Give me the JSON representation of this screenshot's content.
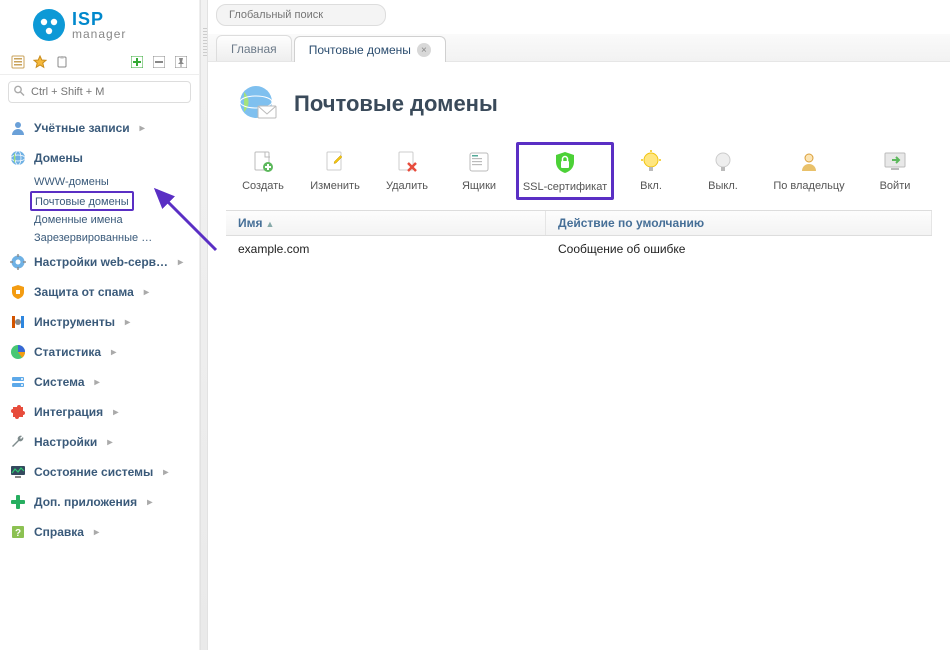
{
  "logo": {
    "brand": "ISP",
    "sub": "manager"
  },
  "search": {
    "placeholder": "Ctrl + Shift + M"
  },
  "global_search": {
    "placeholder": "Глобальный поиск"
  },
  "nav": {
    "accounts": "Учётные записи",
    "domains": "Домены",
    "domains_sub": {
      "www": "WWW-домены",
      "mail": "Почтовые домены",
      "dns": "Доменные имена",
      "reserved": "Зарезервированные …"
    },
    "webserver": "Настройки web-серв…",
    "antispam": "Защита от спама",
    "tools": "Инструменты",
    "stats": "Статистика",
    "system": "Система",
    "integration": "Интеграция",
    "settings": "Настройки",
    "state": "Состояние системы",
    "addons": "Доп. приложения",
    "help": "Справка"
  },
  "tabs": {
    "main": "Главная",
    "mail": "Почтовые домены"
  },
  "page_title": "Почтовые домены",
  "toolbar": {
    "create": "Создать",
    "edit": "Изменить",
    "delete": "Удалить",
    "boxes": "Ящики",
    "ssl": "SSL-сертификат",
    "on": "Вкл.",
    "off": "Выкл.",
    "byowner": "По владельцу",
    "login": "Войти"
  },
  "grid": {
    "col_name": "Имя",
    "col_action": "Действие по умолчанию",
    "rows": [
      {
        "name": "example.com",
        "action": "Сообщение об ошибке"
      }
    ]
  }
}
